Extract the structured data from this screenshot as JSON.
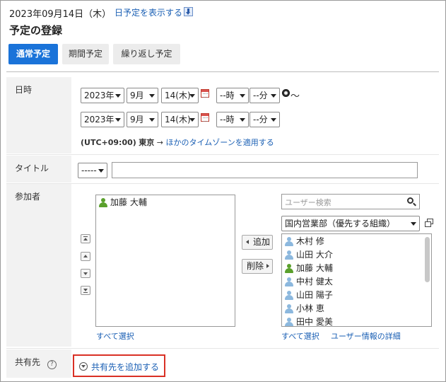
{
  "header": {
    "date": "2023年09月14日（木）",
    "show_day_link": "日予定を表示する",
    "page_title": "予定の登録"
  },
  "tabs": [
    {
      "label": "通常予定",
      "active": true
    },
    {
      "label": "期間予定",
      "active": false
    },
    {
      "label": "繰り返し予定",
      "active": false
    }
  ],
  "datetime": {
    "label": "日時",
    "start": {
      "year": "2023年",
      "month": "9月",
      "day": "14(木)",
      "hour": "--時",
      "minute": "--分"
    },
    "tilde": "～",
    "end": {
      "year": "2023年",
      "month": "9月",
      "day": "14(木)",
      "hour": "--時",
      "minute": "--分"
    },
    "timezone_text": "(UTC+09:00)",
    "timezone_city": "東京",
    "arrow": "→",
    "timezone_link": "ほかのタイムゾーンを適用する"
  },
  "title_row": {
    "label": "タイトル",
    "menu_value": "-----",
    "title_value": ""
  },
  "participants": {
    "label": "参加者",
    "selected": [
      {
        "name": "加藤 大輔",
        "color": "green"
      }
    ],
    "select_all_left": "すべて選択",
    "add_button": "追加",
    "remove_button": "削除",
    "search_placeholder": "ユーザー検索",
    "group_select": "国内営業部（優先する組織）",
    "candidates": [
      {
        "name": "木村 修",
        "color": "blue"
      },
      {
        "name": "山田 大介",
        "color": "blue"
      },
      {
        "name": "加藤 大輔",
        "color": "green"
      },
      {
        "name": "中村 健太",
        "color": "blue"
      },
      {
        "name": "山田 陽子",
        "color": "blue"
      },
      {
        "name": "小林 恵",
        "color": "blue"
      },
      {
        "name": "田中 愛美",
        "color": "blue"
      }
    ],
    "select_all_right": "すべて選択",
    "user_details_link": "ユーザー情報の詳細"
  },
  "share": {
    "label": "共有先",
    "add_link": "共有先を追加する"
  },
  "colors": {
    "accent": "#1a73d9",
    "link": "#1a5fb4",
    "highlight_border": "#d93025"
  }
}
